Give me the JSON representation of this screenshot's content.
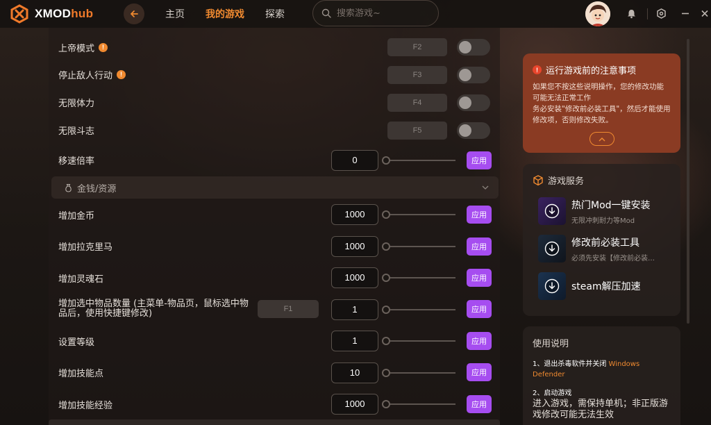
{
  "app": {
    "logo_main": "XMOD",
    "logo_accent": "hub"
  },
  "nav": {
    "items": [
      {
        "label": "主页",
        "active": false
      },
      {
        "label": "我的游戏",
        "active": true
      },
      {
        "label": "探索",
        "active": false
      }
    ]
  },
  "search": {
    "placeholder": "搜索游戏~"
  },
  "cheats": [
    {
      "label": "上帝模式",
      "info": true,
      "hotkey": "F2",
      "toggle": false
    },
    {
      "label": "停止敌人行动",
      "info": true,
      "hotkey": "F3",
      "toggle": false
    },
    {
      "label": "无限体力",
      "info": false,
      "hotkey": "F4",
      "toggle": false
    },
    {
      "label": "无限斗志",
      "info": false,
      "hotkey": "F5",
      "toggle": false
    }
  ],
  "speed": {
    "label": "移速倍率",
    "value": "0",
    "apply": "应用"
  },
  "section": {
    "label": "金钱/资源"
  },
  "resources": [
    {
      "label": "增加金币",
      "value": "1000",
      "apply": "应用"
    },
    {
      "label": "增加拉克里马",
      "value": "1000",
      "apply": "应用"
    },
    {
      "label": "增加灵魂石",
      "value": "1000",
      "apply": "应用"
    },
    {
      "label": "增加选中物品数量 (主菜单-物品页，鼠标选中物品后，使用快捷键修改)",
      "hotkey": "F1",
      "value": "1",
      "apply": "应用"
    },
    {
      "label": "设置等级",
      "value": "1",
      "apply": "应用"
    },
    {
      "label": "增加技能点",
      "value": "10",
      "apply": "应用"
    },
    {
      "label": "增加技能经验",
      "value": "1000",
      "apply": "应用"
    }
  ],
  "notice": {
    "title": "运行游戏前的注意事项",
    "line1": "如果您不按这些说明操作，您的修改功能可能无法正常工作",
    "line2": "务必安装\"修改前必装工具\"，然后才能使用修改项，否则修改失败。"
  },
  "services": {
    "title": "游戏服务",
    "items": [
      {
        "name": "热门Mod一键安装",
        "sub": "无限冲刺耐力等Mod"
      },
      {
        "name": "修改前必装工具",
        "sub": "必须先安装【修改前必装工具】"
      },
      {
        "name": "steam解压加速",
        "sub": ""
      }
    ]
  },
  "usage": {
    "title": "使用说明",
    "step1_prefix": "1、退出杀毒软件并关闭",
    "step1_highlight_a": " Windows",
    "step1_highlight_b": "Defender",
    "step2_title": "2、启动游戏",
    "step2_desc": "进入游戏，需保持单机；非正版游戏修改可能无法生效"
  },
  "colors": {
    "accent": "#f08a30",
    "apply_button": "#a64df0",
    "notice_bg": "#8a3b23"
  }
}
